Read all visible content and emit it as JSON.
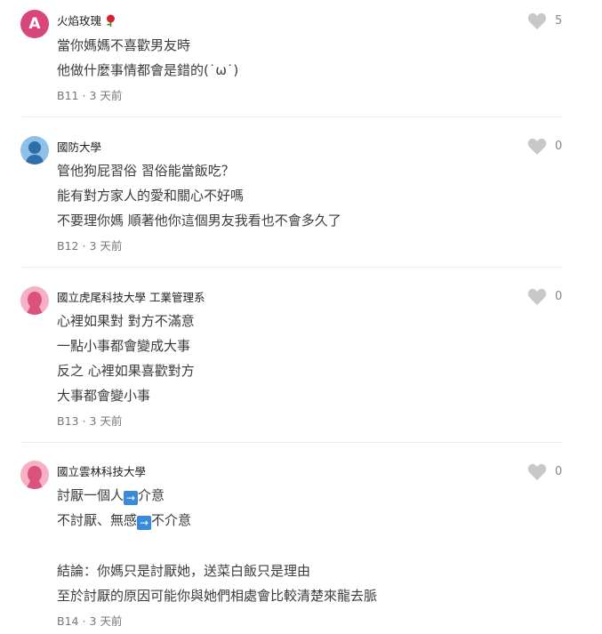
{
  "comments": [
    {
      "author": "火焰玫瑰",
      "author_emoji": "rose-icon",
      "avatar_letter": "A",
      "lines": [
        "當你媽媽不喜歡男友時",
        "他做什麼事情都會是錯的(˙ω˙)"
      ],
      "floor": "B11",
      "time": "3 天前",
      "likes": "5"
    },
    {
      "author": "國防大學",
      "lines": [
        "管他狗屁習俗 習俗能當飯吃？",
        "能有對方家人的愛和關心不好嗎",
        "不要理你媽 順著他你這個男友我看也不會多久了"
      ],
      "floor": "B12",
      "time": "3 天前",
      "likes": "0"
    },
    {
      "author": "國立虎尾科技大學 工業管理系",
      "lines": [
        "心裡如果對 對方不滿意",
        "一點小事都會變成大事",
        "反之 心裡如果喜歡對方",
        "大事都會變小事"
      ],
      "floor": "B13",
      "time": "3 天前",
      "likes": "0"
    },
    {
      "author": "國立雲林科技大學",
      "lines": {
        "l1_a": "討厭一個人",
        "l1_b": "介意",
        "l2_a": "不討厭、無感",
        "l2_b": "不介意",
        "l3": "結論：你媽只是討厭她，送菜白飯只是理由",
        "l4": "至於討厭的原因可能你與她們相處會比較清楚來龍去脈"
      },
      "arrow_glyph": "→",
      "floor": "B14",
      "time": "3 天前",
      "likes": "0"
    }
  ],
  "separator": "·"
}
